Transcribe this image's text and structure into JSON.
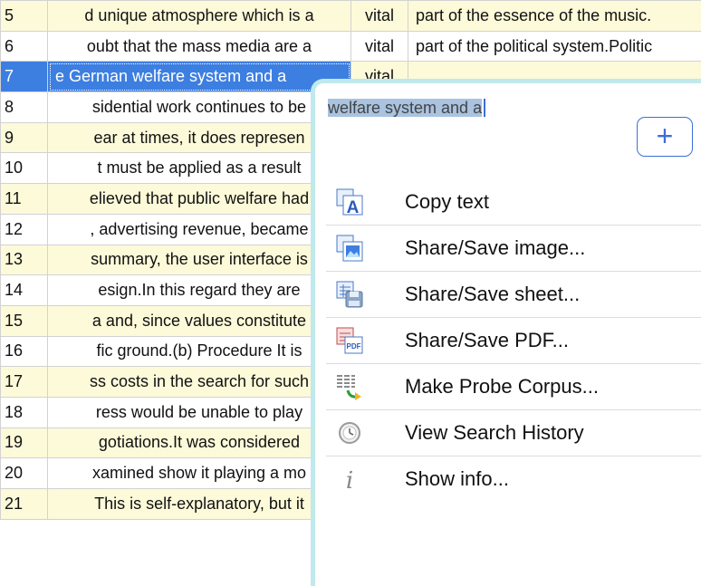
{
  "rows": [
    {
      "num": "5",
      "left": "d unique atmosphere which is a",
      "kw": "vital",
      "right": "part of the essence of the music."
    },
    {
      "num": "6",
      "left": "oubt that the mass media are a",
      "kw": "vital",
      "right": "part of the political system.Politic"
    },
    {
      "num": "7",
      "left": "e German welfare system and a",
      "kw": "vital",
      "right": ""
    },
    {
      "num": "8",
      "left": "sidential work continues to be",
      "kw": "",
      "right": ""
    },
    {
      "num": "9",
      "left": "ear at times, it does represen",
      "kw": "",
      "right": ""
    },
    {
      "num": "10",
      "left": "t must be applied as a result",
      "kw": "",
      "right": ""
    },
    {
      "num": "11",
      "left": "elieved that public welfare had",
      "kw": "",
      "right": ""
    },
    {
      "num": "12",
      "left": ", advertising revenue, became",
      "kw": "",
      "right": ""
    },
    {
      "num": "13",
      "left": "summary, the user interface is",
      "kw": "",
      "right": ""
    },
    {
      "num": "14",
      "left": "esign.In this regard they are",
      "kw": "",
      "right": ""
    },
    {
      "num": "15",
      "left": "a and, since values constitute",
      "kw": "",
      "right": ""
    },
    {
      "num": "16",
      "left": "fic ground.(b) Procedure It is",
      "kw": "",
      "right": ""
    },
    {
      "num": "17",
      "left": "ss costs in the search for such",
      "kw": "",
      "right": ""
    },
    {
      "num": "18",
      "left": "ress would be unable to play",
      "kw": "",
      "right": ""
    },
    {
      "num": "19",
      "left": "gotiations.It was considered",
      "kw": "",
      "right": ""
    },
    {
      "num": "20",
      "left": "xamined show it playing a mo",
      "kw": "",
      "right": ""
    },
    {
      "num": "21",
      "left": "This is self-explanatory, but it",
      "kw": "",
      "right": ""
    }
  ],
  "selected_row": "7",
  "popup": {
    "selected_text": "welfare system and a",
    "add_label": "+",
    "menu": [
      {
        "label": "Copy text",
        "icon": "copy-text-icon"
      },
      {
        "label": "Share/Save image...",
        "icon": "share-image-icon"
      },
      {
        "label": "Share/Save sheet...",
        "icon": "share-sheet-icon"
      },
      {
        "label": "Share/Save PDF...",
        "icon": "share-pdf-icon"
      },
      {
        "label": "Make Probe Corpus...",
        "icon": "probe-corpus-icon"
      },
      {
        "label": "View Search History",
        "icon": "history-icon"
      },
      {
        "label": "Show info...",
        "icon": "info-icon"
      }
    ]
  },
  "colors": {
    "row_odd": "#fcfad9",
    "selection": "#3d7fe0",
    "accent": "#3b6fd6",
    "popup_border": "#bfe9ec"
  }
}
